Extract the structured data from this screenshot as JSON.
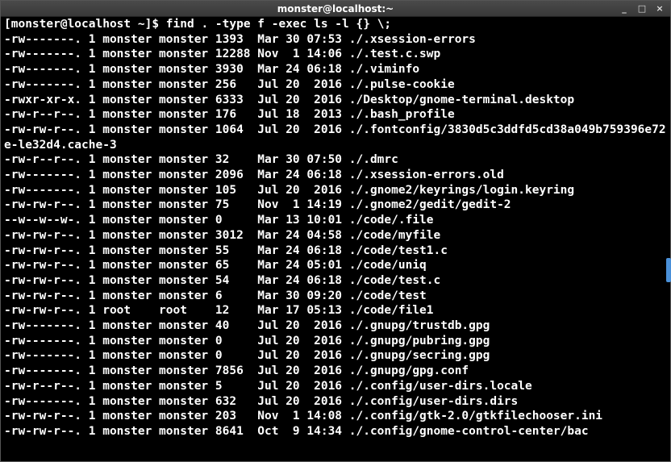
{
  "window": {
    "title": "monster@localhost:~"
  },
  "controls": {
    "minimize": "_",
    "maximize": "□",
    "close": "×"
  },
  "prompt": {
    "text": "[monster@localhost ~]$ "
  },
  "command": "find . -type f -exec ls -l {} \\;",
  "listing": [
    {
      "perm": "-rw-------.",
      "n": "1",
      "own": "monster",
      "grp": "monster",
      "size": "1393",
      "date": "Mar 30 07:53",
      "path": "./.xsession-errors"
    },
    {
      "perm": "-rw-------.",
      "n": "1",
      "own": "monster",
      "grp": "monster",
      "size": "12288",
      "date": "Nov  1 14:06",
      "path": "./.test.c.swp"
    },
    {
      "perm": "-rw-------.",
      "n": "1",
      "own": "monster",
      "grp": "monster",
      "size": "3930",
      "date": "Mar 24 06:18",
      "path": "./.viminfo"
    },
    {
      "perm": "-rw-------.",
      "n": "1",
      "own": "monster",
      "grp": "monster",
      "size": "256",
      "date": "Jul 20  2016",
      "path": "./.pulse-cookie"
    },
    {
      "perm": "-rwxr-xr-x.",
      "n": "1",
      "own": "monster",
      "grp": "monster",
      "size": "6333",
      "date": "Jul 20  2016",
      "path": "./Desktop/gnome-terminal.desktop"
    },
    {
      "perm": "-rw-r--r--.",
      "n": "1",
      "own": "monster",
      "grp": "monster",
      "size": "176",
      "date": "Jul 18  2013",
      "path": "./.bash_profile"
    },
    {
      "perm": "-rw-rw-r--.",
      "n": "1",
      "own": "monster",
      "grp": "monster",
      "size": "1064",
      "date": "Jul 20  2016",
      "path": "./.fontconfig/3830d5c3ddfd5cd38a049b759396e72e-le32d4.cache-3"
    },
    {
      "perm": "-rw-r--r--.",
      "n": "1",
      "own": "monster",
      "grp": "monster",
      "size": "32",
      "date": "Mar 30 07:50",
      "path": "./.dmrc"
    },
    {
      "perm": "-rw-------.",
      "n": "1",
      "own": "monster",
      "grp": "monster",
      "size": "2096",
      "date": "Mar 24 06:18",
      "path": "./.xsession-errors.old"
    },
    {
      "perm": "-rw-------.",
      "n": "1",
      "own": "monster",
      "grp": "monster",
      "size": "105",
      "date": "Jul 20  2016",
      "path": "./.gnome2/keyrings/login.keyring"
    },
    {
      "perm": "-rw-rw-r--.",
      "n": "1",
      "own": "monster",
      "grp": "monster",
      "size": "75",
      "date": "Nov  1 14:19",
      "path": "./.gnome2/gedit/gedit-2"
    },
    {
      "perm": "--w--w--w-.",
      "n": "1",
      "own": "monster",
      "grp": "monster",
      "size": "0",
      "date": "Mar 13 10:01",
      "path": "./code/.file"
    },
    {
      "perm": "-rw-rw-r--.",
      "n": "1",
      "own": "monster",
      "grp": "monster",
      "size": "3012",
      "date": "Mar 24 04:58",
      "path": "./code/myfile"
    },
    {
      "perm": "-rw-rw-r--.",
      "n": "1",
      "own": "monster",
      "grp": "monster",
      "size": "55",
      "date": "Mar 24 06:18",
      "path": "./code/test1.c"
    },
    {
      "perm": "-rw-rw-r--.",
      "n": "1",
      "own": "monster",
      "grp": "monster",
      "size": "65",
      "date": "Mar 24 05:01",
      "path": "./code/uniq"
    },
    {
      "perm": "-rw-rw-r--.",
      "n": "1",
      "own": "monster",
      "grp": "monster",
      "size": "54",
      "date": "Mar 24 06:18",
      "path": "./code/test.c"
    },
    {
      "perm": "-rw-rw-r--.",
      "n": "1",
      "own": "monster",
      "grp": "monster",
      "size": "6",
      "date": "Mar 30 09:20",
      "path": "./code/test"
    },
    {
      "perm": "-rw-rw-r--.",
      "n": "1",
      "own": "root",
      "grp": "root",
      "size": "12",
      "date": "Mar 17 05:13",
      "path": "./code/file1"
    },
    {
      "perm": "-rw-------.",
      "n": "1",
      "own": "monster",
      "grp": "monster",
      "size": "40",
      "date": "Jul 20  2016",
      "path": "./.gnupg/trustdb.gpg"
    },
    {
      "perm": "-rw-------.",
      "n": "1",
      "own": "monster",
      "grp": "monster",
      "size": "0",
      "date": "Jul 20  2016",
      "path": "./.gnupg/pubring.gpg"
    },
    {
      "perm": "-rw-------.",
      "n": "1",
      "own": "monster",
      "grp": "monster",
      "size": "0",
      "date": "Jul 20  2016",
      "path": "./.gnupg/secring.gpg"
    },
    {
      "perm": "-rw-------.",
      "n": "1",
      "own": "monster",
      "grp": "monster",
      "size": "7856",
      "date": "Jul 20  2016",
      "path": "./.gnupg/gpg.conf"
    },
    {
      "perm": "-rw-r--r--.",
      "n": "1",
      "own": "monster",
      "grp": "monster",
      "size": "5",
      "date": "Jul 20  2016",
      "path": "./.config/user-dirs.locale"
    },
    {
      "perm": "-rw-------.",
      "n": "1",
      "own": "monster",
      "grp": "monster",
      "size": "632",
      "date": "Jul 20  2016",
      "path": "./.config/user-dirs.dirs"
    },
    {
      "perm": "-rw-rw-r--.",
      "n": "1",
      "own": "monster",
      "grp": "monster",
      "size": "203",
      "date": "Nov  1 14:08",
      "path": "./.config/gtk-2.0/gtkfilechooser.ini"
    },
    {
      "perm": "-rw-rw-r--.",
      "n": "1",
      "own": "monster",
      "grp": "monster",
      "size": "8641",
      "date": "Oct  9 14:34",
      "path": "./.config/gnome-control-center/bac"
    }
  ]
}
